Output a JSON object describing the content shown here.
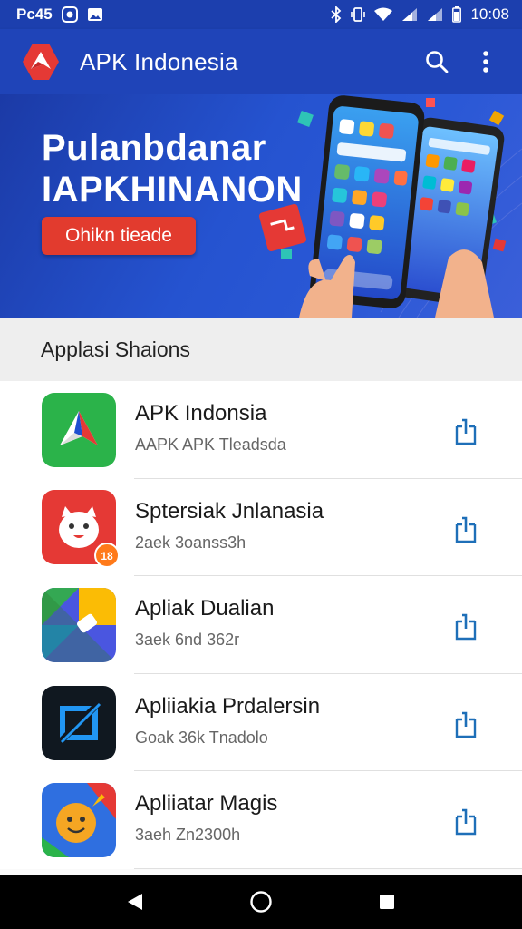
{
  "status_bar": {
    "left_text": "Pc45",
    "time": "10:08"
  },
  "app_bar": {
    "title": "APK Indonesia",
    "search_icon": "search-icon",
    "menu_icon": "more-vert-icon"
  },
  "banner": {
    "title_line1": "Pulanbdanar",
    "title_line2": "IAPKHINANON",
    "cta_label": "Ohikn tieade"
  },
  "section": {
    "title": "Applasi Shaions"
  },
  "apps": [
    {
      "name": "APK Indonsia",
      "subtitle": "AAPK APK Tleadsda",
      "icon": "red-arrow-logo-icon",
      "action_icon": "download-icon"
    },
    {
      "name": "Sptersiak Jnlanasia",
      "subtitle": "2aek 3oanss3h",
      "icon": "cartoon-mascot-icon",
      "action_icon": "download-icon"
    },
    {
      "name": "Apliak Dualian",
      "subtitle": "3aek 6nd 362r",
      "icon": "colorful-play-icon",
      "action_icon": "download-icon"
    },
    {
      "name": "Apliiakia Prdalersin",
      "subtitle": "Goak 36k Tnadolo",
      "icon": "slash-frame-icon",
      "action_icon": "download-icon"
    },
    {
      "name": "Apliiatar Magis",
      "subtitle": "3aeh Zn2300h",
      "icon": "smiley-face-icon",
      "action_icon": "download-icon"
    }
  ],
  "nav_bar": {
    "back_icon": "back-icon",
    "home_icon": "home-icon",
    "recents_icon": "recents-icon"
  },
  "colors": {
    "primary": "#1f44b8",
    "accent": "#e23b2e",
    "action": "#1e6fb8"
  }
}
